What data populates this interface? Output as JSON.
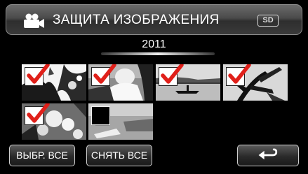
{
  "header": {
    "title": "ЗАЩИТА ИЗОБРАЖЕНИЯ",
    "mode_icon": "video-camera-icon",
    "media_label": "SD"
  },
  "group": {
    "year": "2011"
  },
  "thumbnails": [
    {
      "scene": "bright-foliage",
      "checked": true
    },
    {
      "scene": "person-reading",
      "checked": true
    },
    {
      "scene": "lake-canoe",
      "checked": true
    },
    {
      "scene": "palm-leaves",
      "checked": true
    },
    {
      "scene": "blossoms",
      "checked": true
    },
    {
      "scene": "grey-scene",
      "checked": false
    }
  ],
  "buttons": {
    "select_all": "ВЫБР. ВСЕ",
    "deselect_all": "СНЯТЬ ВСЕ",
    "back_icon": "return-arrow-icon"
  },
  "colors": {
    "check_mark": "#e0201a",
    "background": "#000000"
  }
}
